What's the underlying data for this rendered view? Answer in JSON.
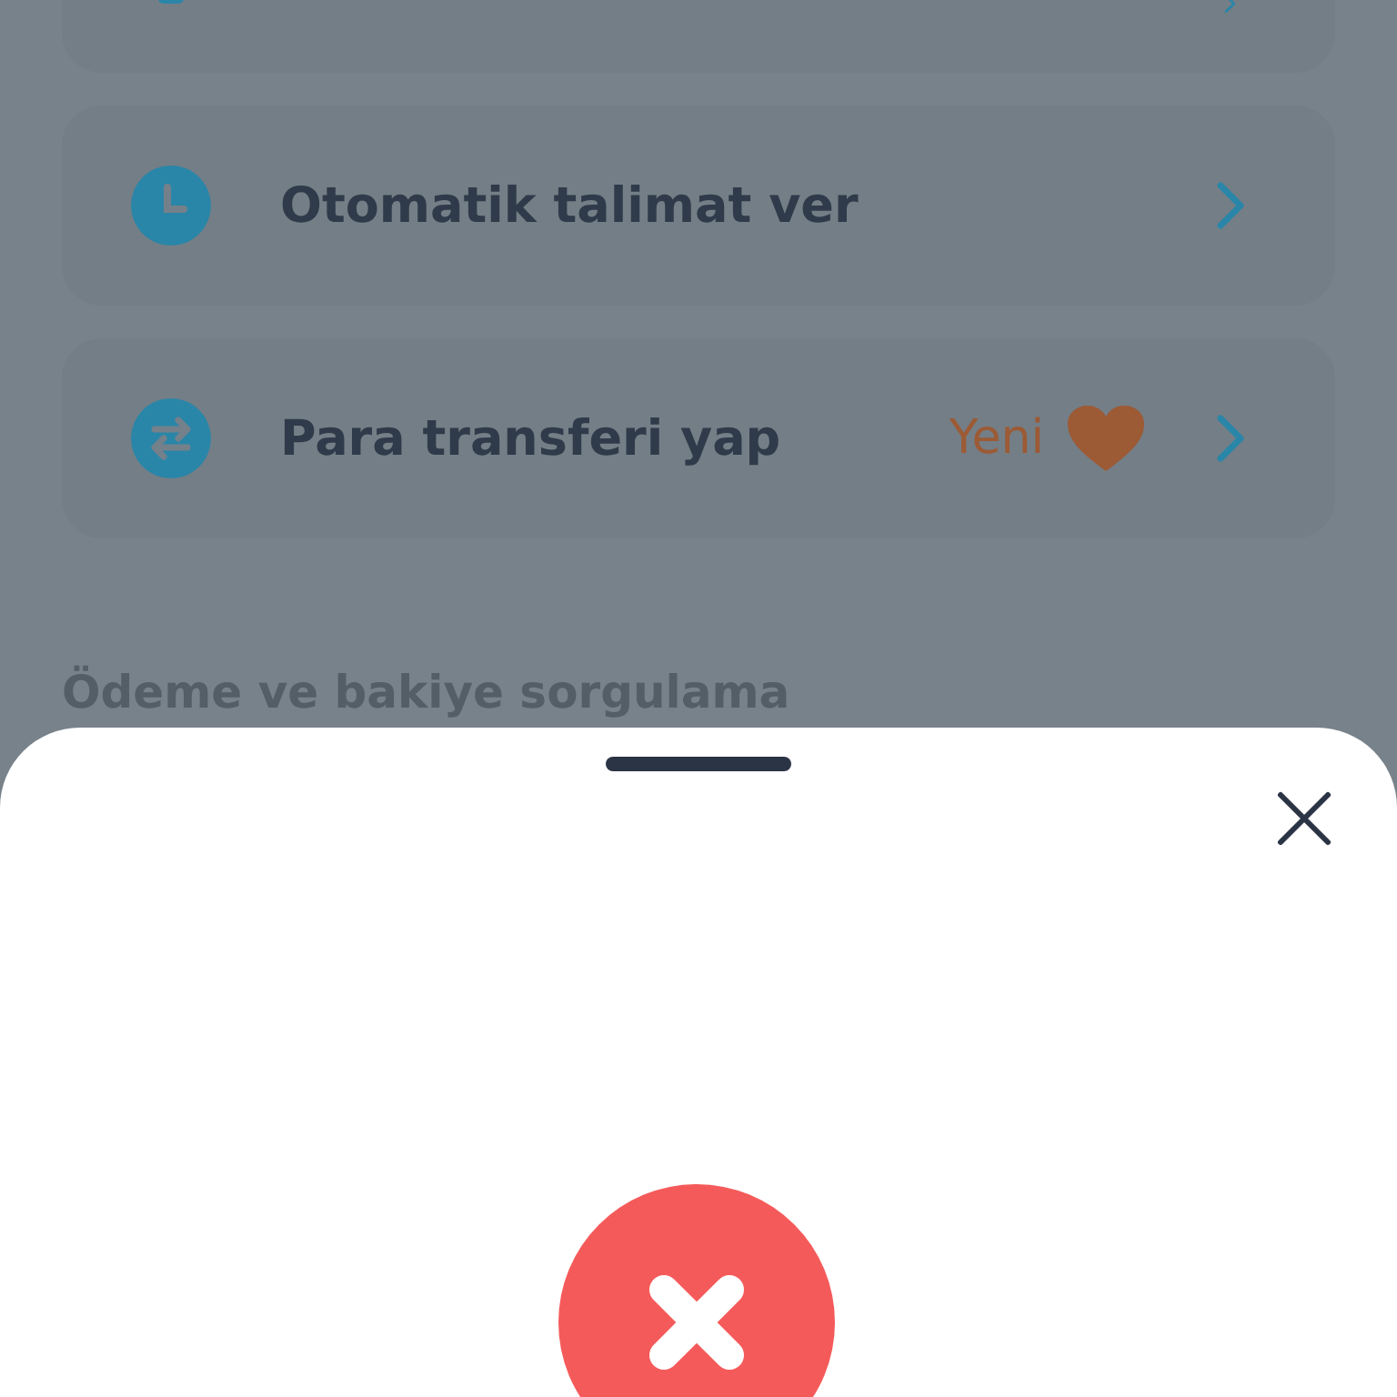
{
  "menu_items": [
    {
      "kind": "cut"
    },
    {
      "kind": "clock",
      "label": "Otomatik talimat ver"
    },
    {
      "kind": "transfer",
      "label": "Para transferi yap",
      "badge": "Yeni"
    }
  ],
  "section_title": "Ödeme ve bakiye sorgulama",
  "sheet": {
    "error": true
  }
}
